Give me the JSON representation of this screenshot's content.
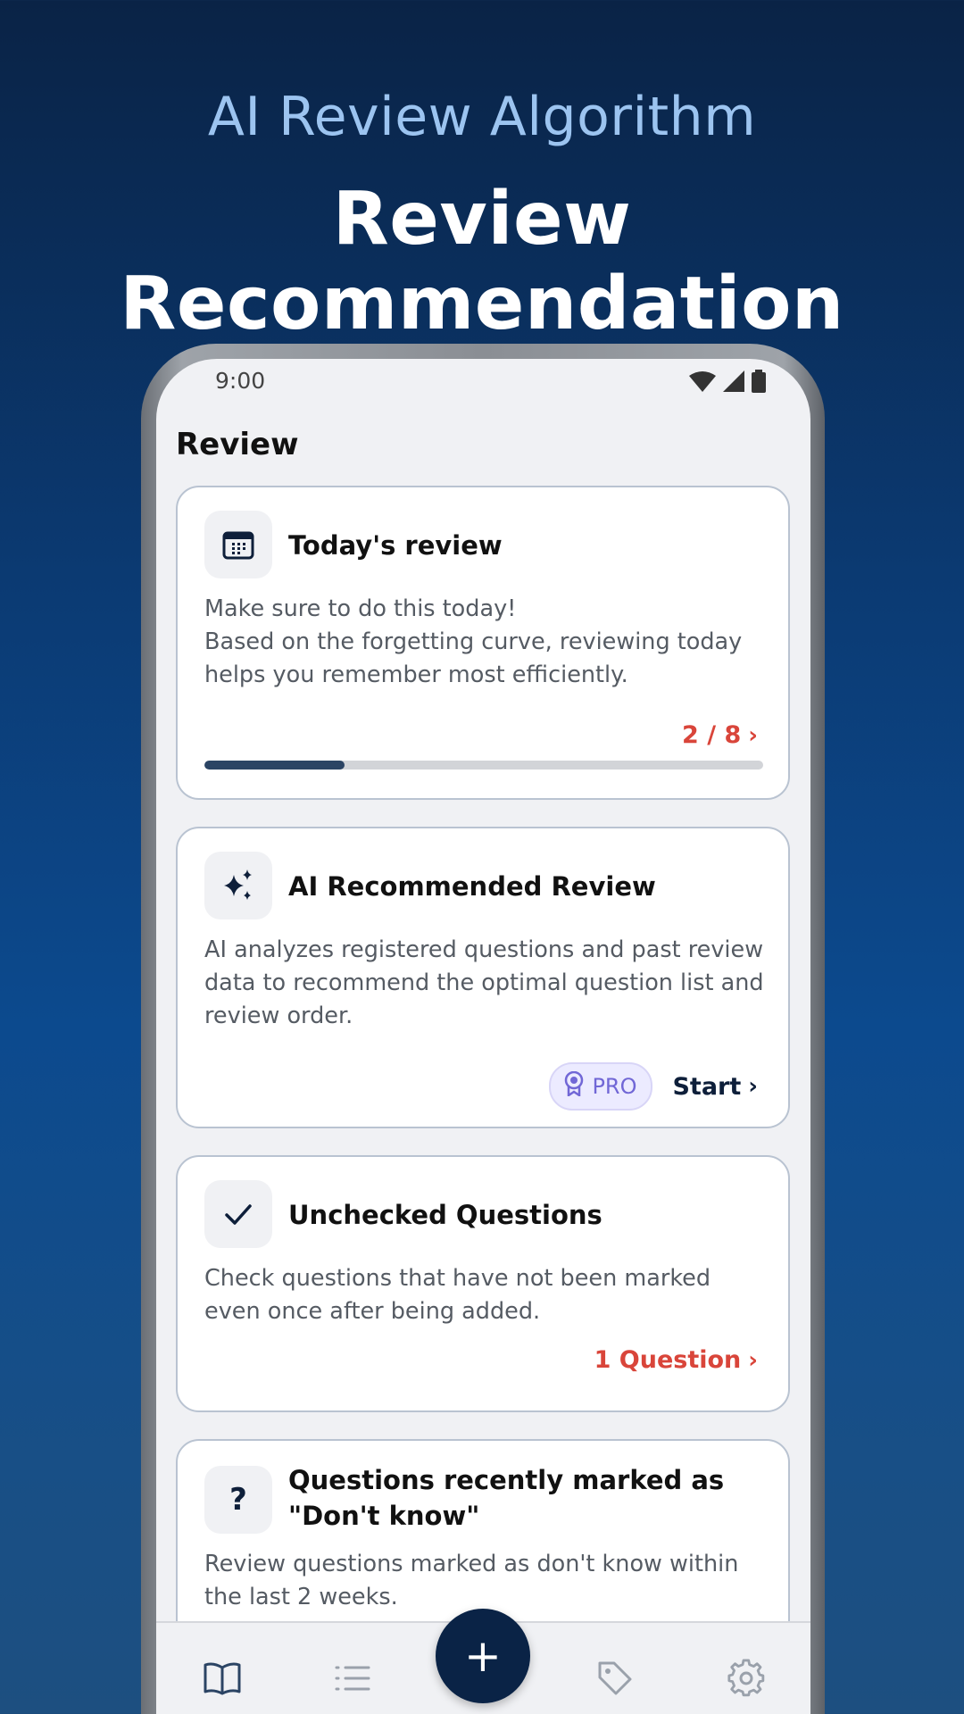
{
  "hero": {
    "subtitle": "AI Review Algorithm",
    "title": "Review Recommendation"
  },
  "status_bar": {
    "time": "9:00",
    "icons": [
      "wifi-icon",
      "cellular-signal-icon",
      "battery-icon"
    ]
  },
  "page": {
    "heading": "Review"
  },
  "cards": [
    {
      "icon": "calendar-icon",
      "title": "Today's review",
      "description": "Make sure to do this today!\nBased on the forgetting curve, reviewing today helps you remember most efficiently.",
      "action": "2 / 8",
      "progress": {
        "completed": 2,
        "total": 8,
        "fraction": 0.25
      }
    },
    {
      "icon": "sparkles-icon",
      "title": "AI Recommended Review",
      "description": "AI analyzes registered questions and past review data to recommend the optimal question list and review order.",
      "badge": "PRO",
      "badge_icon": "award-ribbon-icon",
      "action": "Start"
    },
    {
      "icon": "checkmark-icon",
      "title": "Unchecked Questions",
      "description": "Check questions that have not been marked even once after being added.",
      "action": "1 Question"
    },
    {
      "icon": "question-mark-icon",
      "title": "Questions recently marked as \"Don't know\"",
      "description": "Review questions marked as don't know within the last 2 weeks."
    }
  ],
  "bottom_nav": {
    "items": [
      "book-icon",
      "list-icon",
      "plus-icon",
      "tag-icon",
      "gear-icon"
    ],
    "active": "book-icon",
    "fab_label": "+"
  },
  "colors": {
    "background_top": "#0a2346",
    "background_bottom": "#1d4f80",
    "accent_red": "#d9453a",
    "navy": "#0a2346",
    "pro_purple": "#7167d6"
  }
}
